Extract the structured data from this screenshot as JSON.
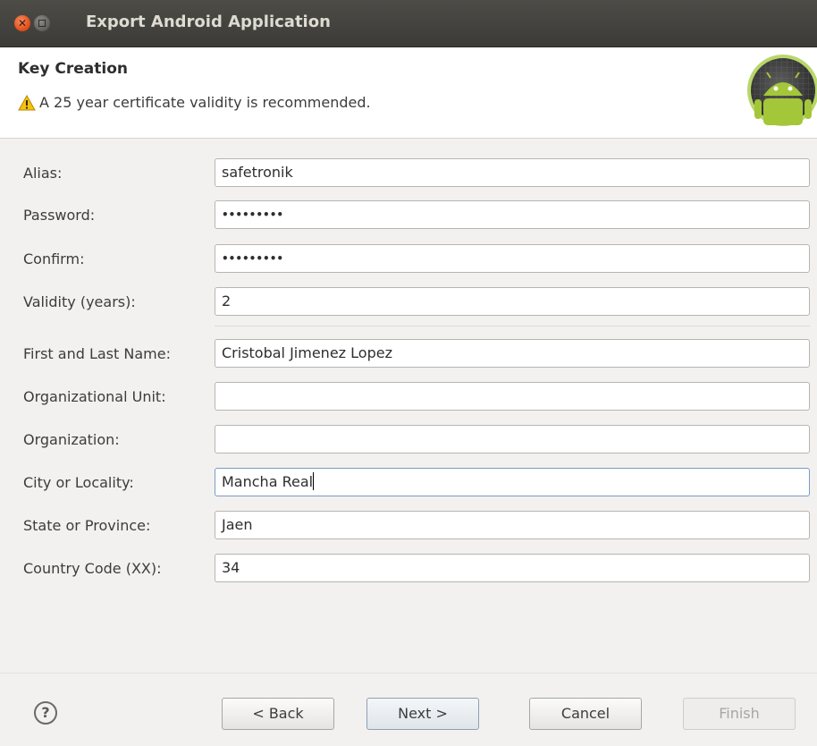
{
  "window": {
    "title": "Export Android Application"
  },
  "banner": {
    "title": "Key Creation",
    "message": "A 25 year certificate validity is recommended."
  },
  "form": {
    "alias": {
      "label": "Alias:",
      "value": "safetronik"
    },
    "password": {
      "label": "Password:",
      "value": "•••••••••"
    },
    "confirm": {
      "label": "Confirm:",
      "value": "•••••••••"
    },
    "validity": {
      "label": "Validity (years):",
      "value": "2"
    },
    "name": {
      "label": "First and Last Name:",
      "value": "Cristobal Jimenez Lopez"
    },
    "org_unit": {
      "label": "Organizational Unit:",
      "value": ""
    },
    "organization": {
      "label": "Organization:",
      "value": ""
    },
    "city": {
      "label": "City or Locality:",
      "value": "Mancha Real"
    },
    "state": {
      "label": "State or Province:",
      "value": "Jaen"
    },
    "country": {
      "label": "Country Code (XX):",
      "value": "34"
    }
  },
  "buttons": {
    "help": "?",
    "back": "< Back",
    "next": "Next >",
    "cancel": "Cancel",
    "finish": "Finish"
  },
  "icons": {
    "close": "close-icon",
    "maximize": "maximize-icon",
    "warning": "warning-icon",
    "android": "android-logo-icon",
    "help": "help-icon"
  },
  "colors": {
    "titlebar": "#3c3b37",
    "close_button": "#df4a16",
    "android_green": "#a4c639"
  }
}
